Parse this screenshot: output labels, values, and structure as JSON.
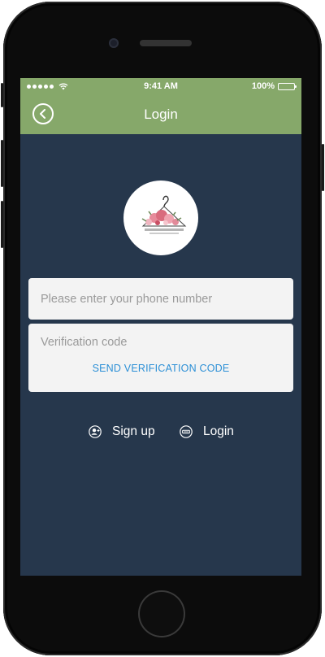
{
  "status_bar": {
    "time": "9:41 AM",
    "battery": "100%",
    "battery_level": 1.0,
    "signal_bars": 5,
    "wifi_icon": "wifi-icon"
  },
  "nav": {
    "title": "Login",
    "back_icon": "chevron-left-circle-icon"
  },
  "logo": {
    "alt": "boutique logo",
    "icon": "hanger-floral-logo"
  },
  "form": {
    "phone_placeholder": "Please enter your phone number",
    "phone_value": "",
    "code_placeholder": "Verification code",
    "code_value": "",
    "send_code_label": "SEND VERIFICATION CODE"
  },
  "links": {
    "signup_label": "Sign up",
    "login_label": "Login",
    "signup_icon": "user-add-icon",
    "login_icon": "login-icon"
  },
  "colors": {
    "header": "#86a86a",
    "background": "#26374c",
    "card": "#f3f3f3",
    "accent": "#2b8fd6",
    "text_light": "#ffffff"
  }
}
